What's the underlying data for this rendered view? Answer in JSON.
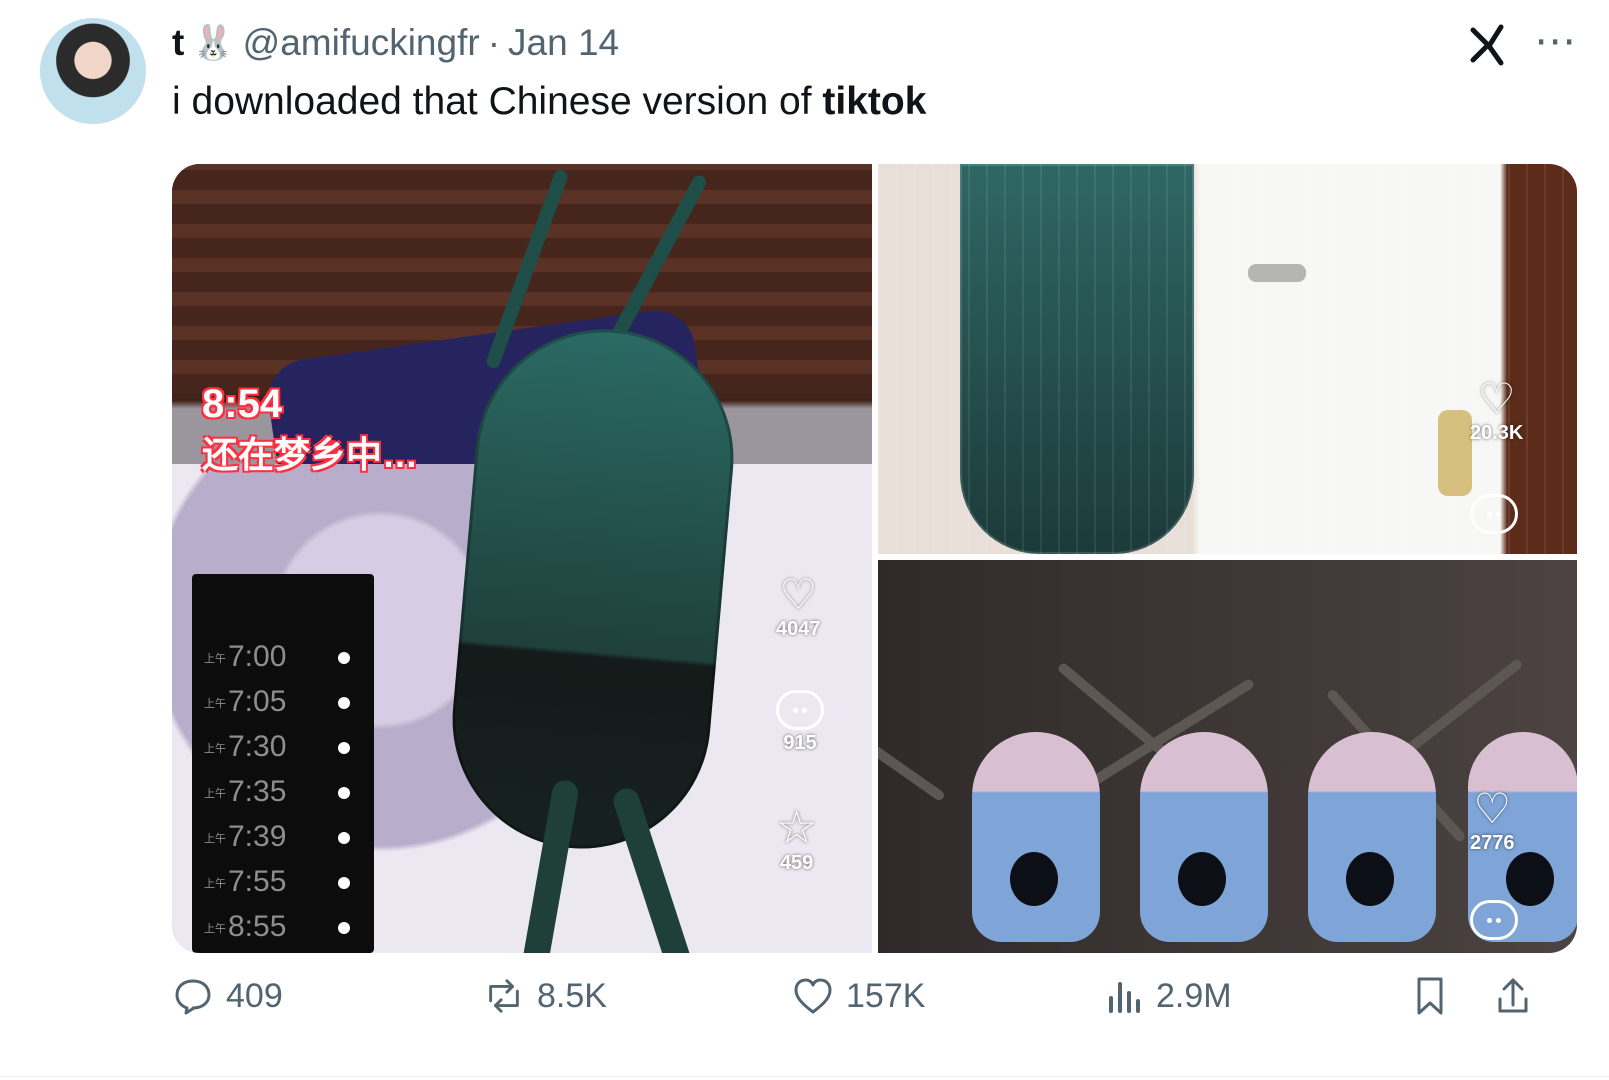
{
  "author": {
    "display_name": "t",
    "bunny_glyph": "🐰",
    "handle": "@amifuckingfr",
    "separator": "·",
    "date": "Jan 14"
  },
  "post": {
    "text_prefix": "i downloaded that Chinese version of ",
    "text_bold": "tiktok"
  },
  "media": {
    "panel_1": {
      "caption_time": "8:54",
      "caption_text": "还在梦乡中…",
      "alarms": [
        "7:00",
        "7:05",
        "7:30",
        "7:35",
        "7:39",
        "7:55",
        "8:55"
      ],
      "alarm_prefix": "上午",
      "likes": "4047",
      "comments": "915",
      "favorites": "459"
    },
    "panel_2": {
      "likes": "20.3K"
    },
    "panel_3": {
      "likes": "2776"
    }
  },
  "actions": {
    "replies": "409",
    "reposts": "8.5K",
    "likes": "157K",
    "views": "2.9M"
  }
}
